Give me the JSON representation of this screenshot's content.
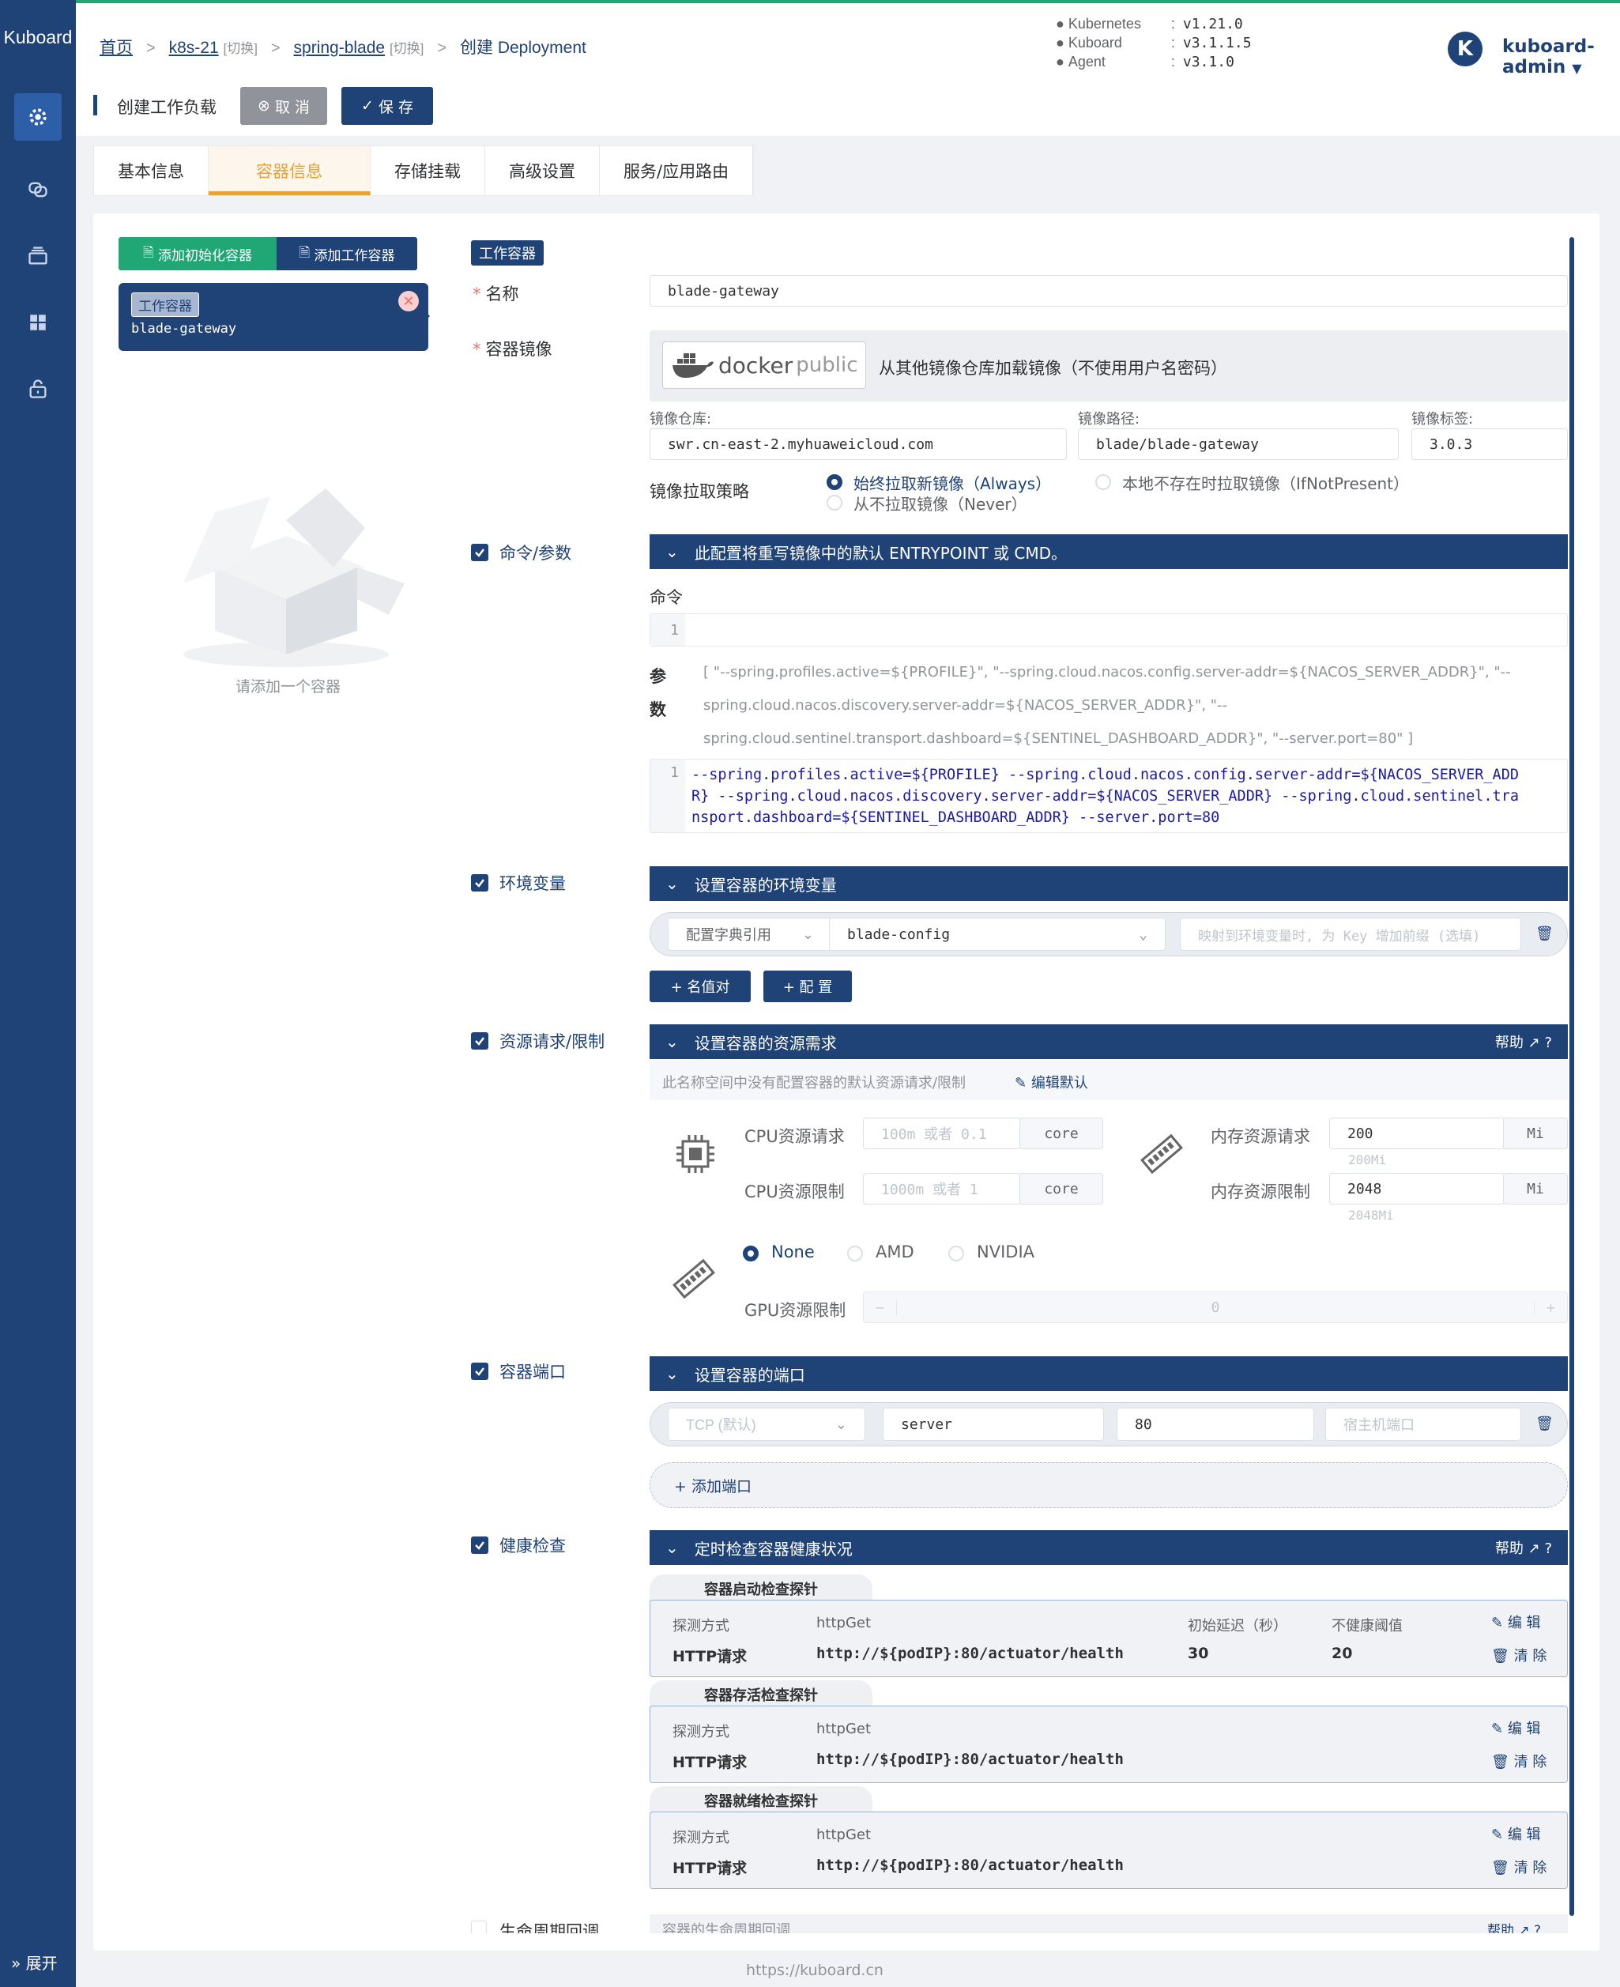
{
  "app": {
    "logo": "Kuboard",
    "expand": "展开"
  },
  "breadcrumb": {
    "home": "首页",
    "cluster": "k8s-21",
    "cluster_switch": "[切换]",
    "namespace": "spring-blade",
    "namespace_switch": "[切换]",
    "current": "创建 Deployment"
  },
  "versions": [
    {
      "name": "Kubernetes",
      "value": "v1.21.0"
    },
    {
      "name": "Kuboard",
      "value": "v3.1.1.5"
    },
    {
      "name": "Agent",
      "value": "v3.1.0"
    }
  ],
  "user": {
    "avatar_letter": "K",
    "name": "kuboard-admin"
  },
  "toolbar": {
    "title": "创建工作负载",
    "cancel": "取 消",
    "save": "保 存"
  },
  "tabs": [
    "基本信息",
    "容器信息",
    "存储挂载",
    "高级设置",
    "服务/应用路由"
  ],
  "containers": {
    "add_init": "添加初始化容器",
    "add_work": "添加工作容器",
    "card_tag": "工作容器",
    "card_name": "blade-gateway",
    "empty_hint": "请添加一个容器"
  },
  "form": {
    "type_tag": "工作容器",
    "name_label": "名称",
    "name_value": "blade-gateway",
    "image_label": "容器镜像",
    "docker_brand": "docker",
    "docker_sub": "public",
    "image_source": "从其他镜像仓库加载镜像（不使用用户名密码）",
    "registry_label": "镜像仓库:",
    "registry_value": "swr.cn-east-2.myhuaweicloud.com",
    "path_label": "镜像路径:",
    "path_value": "blade/blade-gateway",
    "tag_label": "镜像标签:",
    "tag_value": "3.0.3",
    "pull_label": "镜像拉取策略",
    "pull_always": "始终拉取新镜像（Always）",
    "pull_ifnot": "本地不存在时拉取镜像（IfNotPresent）",
    "pull_never": "从不拉取镜像（Never）"
  },
  "command": {
    "label": "命令/参数",
    "bar": "此配置将重写镜像中的默认 ENTRYPOINT 或 CMD。",
    "cmd_label": "命令",
    "line1": "1",
    "args_label_1": "参",
    "args_label_2": "数",
    "args_preview_1": "[ \"--spring.profiles.active=${PROFILE}\", \"--spring.cloud.nacos.config.server-addr=${NACOS_SERVER_ADDR}\", \"--",
    "args_preview_2": "spring.cloud.nacos.discovery.server-addr=${NACOS_SERVER_ADDR}\", \"--",
    "args_preview_3": "spring.cloud.sentinel.transport.dashboard=${SENTINEL_DASHBOARD_ADDR}\", \"--server.port=80\" ]",
    "code_1": "--spring.profiles.active=${PROFILE} --spring.cloud.nacos.config.server-addr=${NACOS_SERVER_ADD",
    "code_2": "R} --spring.cloud.nacos.discovery.server-addr=${NACOS_SERVER_ADDR} --spring.cloud.sentinel.tra",
    "code_3": "nsport.dashboard=${SENTINEL_DASHBOARD_ADDR} --server.port=80"
  },
  "env": {
    "label": "环境变量",
    "bar": "设置容器的环境变量",
    "type": "配置字典引用",
    "config": "blade-config",
    "prefix_ph": "映射到环境变量时, 为 Key 增加前缀 (选填)",
    "add_kv": "+ 名值对",
    "add_cfg": "+ 配 置"
  },
  "resources": {
    "label": "资源请求/限制",
    "bar": "设置容器的资源需求",
    "help": "帮助",
    "note": "此名称空间中没有配置容器的默认资源请求/限制",
    "edit_default": "编辑默认",
    "cpu_req": "CPU资源请求",
    "cpu_req_ph": "100m 或者 0.1",
    "cpu_lim": "CPU资源限制",
    "cpu_lim_ph": "1000m 或者 1",
    "core": "core",
    "mem_req": "内存资源请求",
    "mem_req_value": "200",
    "mem_req_hint": "200Mi",
    "mem_lim": "内存资源限制",
    "mem_lim_value": "2048",
    "mem_lim_hint": "2048Mi",
    "mi": "Mi",
    "gpu_none": "None",
    "gpu_amd": "AMD",
    "gpu_nvidia": "NVIDIA",
    "gpu_lim": "GPU资源限制",
    "gpu_value": "0"
  },
  "ports": {
    "label": "容器端口",
    "bar": "设置容器的端口",
    "protocol": "TCP (默认)",
    "name": "server",
    "port": "80",
    "host_ph": "宿主机端口",
    "add": "+ 添加端口"
  },
  "health": {
    "label": "健康检查",
    "bar": "定时检查容器健康状况",
    "help": "帮助",
    "probes": [
      {
        "title": "容器启动检查探针",
        "method_k": "探测方式",
        "method_v": "httpGet",
        "type": "HTTP请求",
        "url": "http://${podIP}:80/actuator/health",
        "delay_k": "初始延迟（秒）",
        "delay_v": "30",
        "thr_k": "不健康阈值",
        "thr_v": "20",
        "edit": "编 辑",
        "clear": "清 除"
      },
      {
        "title": "容器存活检查探针",
        "method_k": "探测方式",
        "method_v": "httpGet",
        "type": "HTTP请求",
        "url": "http://${podIP}:80/actuator/health",
        "edit": "编 辑",
        "clear": "清 除"
      },
      {
        "title": "容器就绪检查探针",
        "method_k": "探测方式",
        "method_v": "httpGet",
        "type": "HTTP请求",
        "url": "http://${podIP}:80/actuator/health",
        "edit": "编 辑",
        "clear": "清 除"
      }
    ]
  },
  "lifecycle": {
    "label": "生命周期回调",
    "bar": "容器的生命周期回调",
    "help": "帮助"
  },
  "footer": {
    "url": "https://kuboard.cn"
  },
  "colors": {
    "brand": "#1f4277",
    "accent": "#e6a23c",
    "green": "#21a675",
    "danger": "#f56c6c"
  }
}
